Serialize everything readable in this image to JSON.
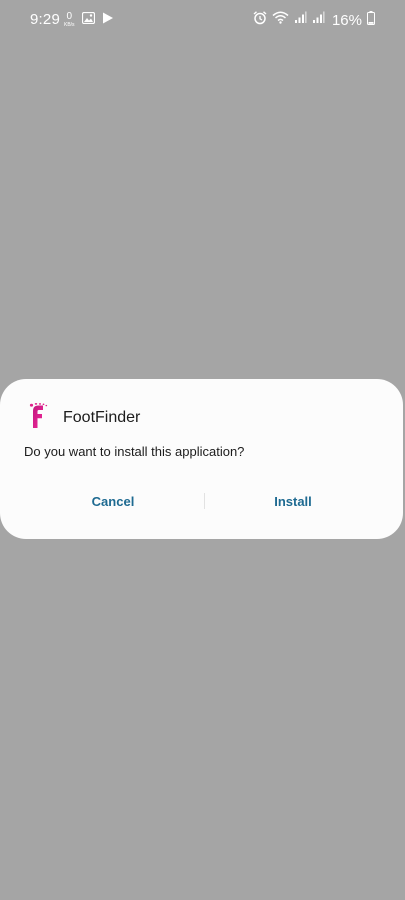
{
  "status_bar": {
    "time": "9:29",
    "net_speed_value": "0",
    "net_speed_unit": "KB/s",
    "battery_percent": "16%",
    "left_icons": [
      "gallery-icon",
      "play-store-icon"
    ],
    "right_icons": [
      "alarm-icon",
      "wifi-icon",
      "signal-icon",
      "signal-icon",
      "battery-icon"
    ]
  },
  "dialog": {
    "app_name": "FootFinder",
    "app_icon": "footfinder-logo-icon",
    "message": "Do you want to install this application?",
    "cancel_label": "Cancel",
    "install_label": "Install"
  },
  "colors": {
    "backdrop": "#a5a5a5",
    "dialog_background": "#fcfcfc",
    "button_text": "#1e6a91",
    "app_icon_accent": "#e0218a"
  }
}
